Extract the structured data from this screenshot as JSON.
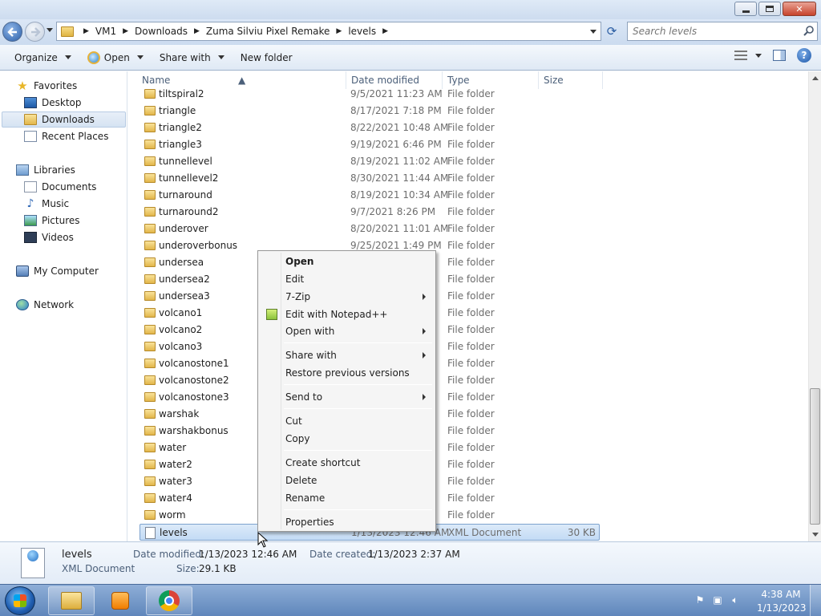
{
  "address": {
    "crumbs": [
      "VM1",
      "Downloads",
      "Zuma Silviu Pixel Remake",
      "levels"
    ],
    "search_placeholder": "Search levels"
  },
  "toolbar": {
    "organize": "Organize",
    "open": "Open",
    "share_with": "Share with",
    "new_folder": "New folder"
  },
  "nav": {
    "favorites": "Favorites",
    "desktop": "Desktop",
    "downloads": "Downloads",
    "recent_places": "Recent Places",
    "libraries": "Libraries",
    "documents": "Documents",
    "music": "Music",
    "pictures": "Pictures",
    "videos": "Videos",
    "my_computer": "My Computer",
    "network": "Network"
  },
  "columns": {
    "name": "Name",
    "date_modified": "Date modified",
    "type": "Type",
    "size": "Size"
  },
  "files": [
    {
      "name": "tiltspiral2",
      "date": "9/5/2021 11:23 AM",
      "type": "File folder"
    },
    {
      "name": "triangle",
      "date": "8/17/2021 7:18 PM",
      "type": "File folder"
    },
    {
      "name": "triangle2",
      "date": "8/22/2021 10:48 AM",
      "type": "File folder"
    },
    {
      "name": "triangle3",
      "date": "9/19/2021 6:46 PM",
      "type": "File folder"
    },
    {
      "name": "tunnellevel",
      "date": "8/19/2021 11:02 AM",
      "type": "File folder"
    },
    {
      "name": "tunnellevel2",
      "date": "8/30/2021 11:44 AM",
      "type": "File folder"
    },
    {
      "name": "turnaround",
      "date": "8/19/2021 10:34 AM",
      "type": "File folder"
    },
    {
      "name": "turnaround2",
      "date": "9/7/2021 8:26 PM",
      "type": "File folder"
    },
    {
      "name": "underover",
      "date": "8/20/2021 11:01 AM",
      "type": "File folder"
    },
    {
      "name": "underoverbonus",
      "date": "9/25/2021 1:49 PM",
      "type": "File folder"
    },
    {
      "name": "undersea",
      "date": "",
      "type": "File folder"
    },
    {
      "name": "undersea2",
      "date": "",
      "type": "File folder"
    },
    {
      "name": "undersea3",
      "date": "",
      "type": "File folder"
    },
    {
      "name": "volcano1",
      "date": "",
      "type": "File folder"
    },
    {
      "name": "volcano2",
      "date": "",
      "type": "File folder"
    },
    {
      "name": "volcano3",
      "date": "",
      "type": "File folder"
    },
    {
      "name": "volcanostone1",
      "date": "",
      "type": "File folder"
    },
    {
      "name": "volcanostone2",
      "date": "",
      "type": "File folder"
    },
    {
      "name": "volcanostone3",
      "date": "",
      "type": "File folder"
    },
    {
      "name": "warshak",
      "date": "",
      "type": "File folder"
    },
    {
      "name": "warshakbonus",
      "date": "",
      "type": "File folder"
    },
    {
      "name": "water",
      "date": "",
      "type": "File folder"
    },
    {
      "name": "water2",
      "date": "",
      "type": "File folder"
    },
    {
      "name": "water3",
      "date": "",
      "type": "File folder"
    },
    {
      "name": "water4",
      "date": "",
      "type": "File folder"
    },
    {
      "name": "worm",
      "date": "",
      "type": "File folder"
    }
  ],
  "selected_file": {
    "name": "levels",
    "date": "1/13/2023 12:46 AM",
    "type": "XML Document",
    "size": "30 KB"
  },
  "context_menu": {
    "open": "Open",
    "edit": "Edit",
    "seven_zip": "7-Zip",
    "edit_notepadpp": "Edit with Notepad++",
    "open_with": "Open with",
    "share_with": "Share with",
    "restore_previous": "Restore previous versions",
    "send_to": "Send to",
    "cut": "Cut",
    "copy": "Copy",
    "create_shortcut": "Create shortcut",
    "delete": "Delete",
    "rename": "Rename",
    "properties": "Properties"
  },
  "details": {
    "name": "levels",
    "type": "XML Document",
    "date_modified_label": "Date modified:",
    "date_modified": "1/13/2023 12:46 AM",
    "date_created_label": "Date created:",
    "date_created": "1/13/2023 2:37 AM",
    "size_label": "Size:",
    "size": "29.1 KB"
  },
  "taskbar": {
    "time": "4:38 AM",
    "date": "1/13/2023"
  }
}
